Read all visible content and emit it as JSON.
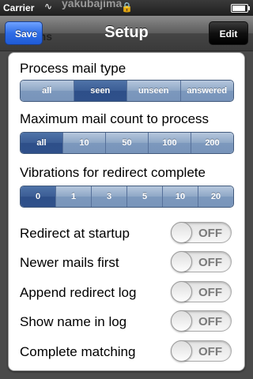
{
  "status": {
    "carrier": "Carrier",
    "ghost_text": "yakubajima"
  },
  "navbar": {
    "title": "Setup",
    "save_label": "Save",
    "edit_label": "Edit",
    "ghost_text": "ptions"
  },
  "sections": {
    "mail_type": {
      "label": "Process mail type",
      "options": [
        "all",
        "seen",
        "unseen",
        "answered"
      ],
      "selected": "seen"
    },
    "max_count": {
      "label": "Maximum mail count to process",
      "options": [
        "all",
        "10",
        "50",
        "100",
        "200"
      ],
      "selected": "all"
    },
    "vibrations": {
      "label": "Vibrations for redirect complete",
      "options": [
        "0",
        "1",
        "3",
        "5",
        "10",
        "20"
      ],
      "selected": "0"
    }
  },
  "toggles": [
    {
      "label": "Redirect at startup",
      "state": "OFF"
    },
    {
      "label": "Newer mails first",
      "state": "OFF"
    },
    {
      "label": "Append redirect log",
      "state": "OFF"
    },
    {
      "label": "Show name in log",
      "state": "OFF"
    },
    {
      "label": "Complete matching",
      "state": "OFF"
    }
  ]
}
